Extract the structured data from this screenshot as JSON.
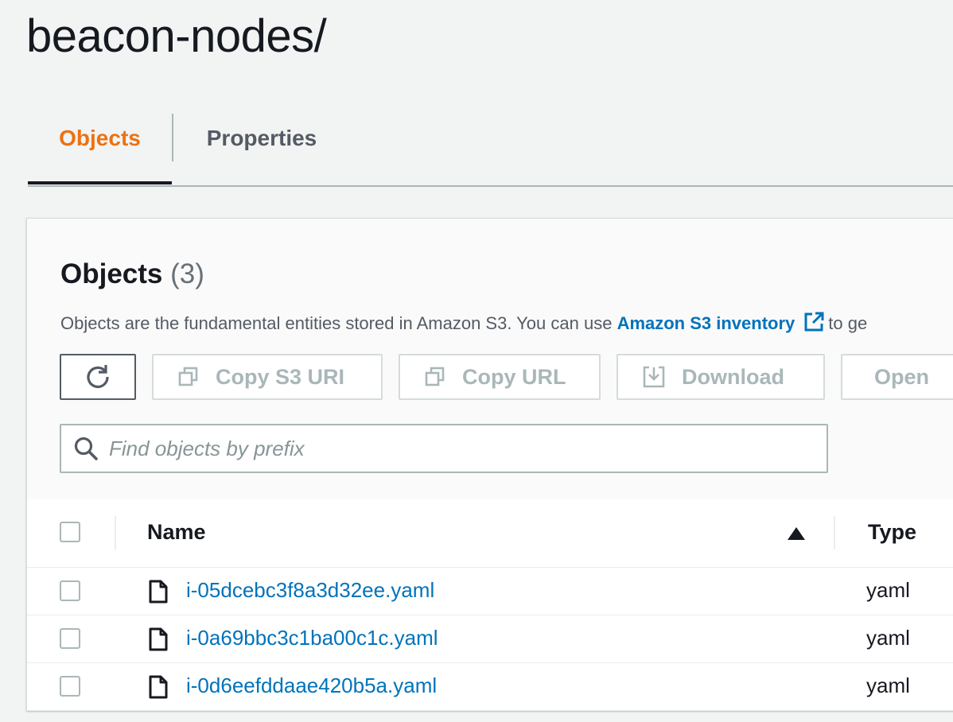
{
  "page": {
    "title": "beacon-nodes/"
  },
  "tabs": [
    {
      "label": "Objects",
      "active": true
    },
    {
      "label": "Properties",
      "active": false
    }
  ],
  "objects_panel": {
    "heading": "Objects",
    "count": "(3)",
    "description_prefix": "Objects are the fundamental entities stored in Amazon S3. You can use ",
    "inventory_link": "Amazon S3 inventory",
    "description_suffix": "to ge"
  },
  "toolbar": {
    "refresh_icon": "refresh-icon",
    "copy_s3_uri_label": "Copy S3 URI",
    "copy_url_label": "Copy URL",
    "download_label": "Download",
    "open_label": "Open"
  },
  "search": {
    "placeholder": "Find objects by prefix",
    "value": ""
  },
  "table": {
    "columns": {
      "name": "Name",
      "type": "Type"
    },
    "sort": {
      "column": "Name",
      "direction": "ascending"
    },
    "rows": [
      {
        "name": "i-05dcebc3f8a3d32ee.yaml",
        "type": "yaml"
      },
      {
        "name": "i-0a69bbc3c1ba00c1c.yaml",
        "type": "yaml"
      },
      {
        "name": "i-0d6eefddaae420b5a.yaml",
        "type": "yaml"
      }
    ]
  },
  "colors": {
    "accent": "#ec7211",
    "link": "#0073bb",
    "text": "#16191f",
    "disabled": "#aab7b8",
    "background": "#f2f3f3"
  }
}
